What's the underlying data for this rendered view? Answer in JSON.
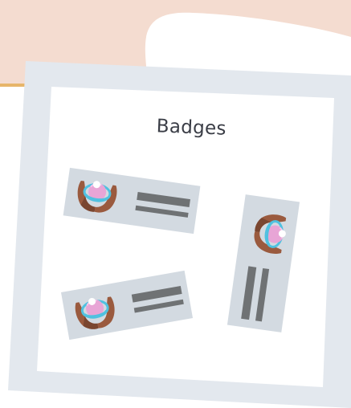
{
  "card": {
    "title": "Badges"
  },
  "colors": {
    "background_blob": "#f4dcd0",
    "blob_shadow": "#e7b56a",
    "frame": "#e3e8ee",
    "panel": "#ffffff",
    "badge": "#d3dae1",
    "bar": "#6f7274",
    "skin": "#9a5a3e",
    "skin_dark": "#7a4630",
    "ring": "#4fc1e0",
    "orb": "#e8a5d6",
    "orb_highlight": "#ffffff"
  },
  "icons": {
    "badge_emblem": "hands-holding-orb-icon"
  }
}
